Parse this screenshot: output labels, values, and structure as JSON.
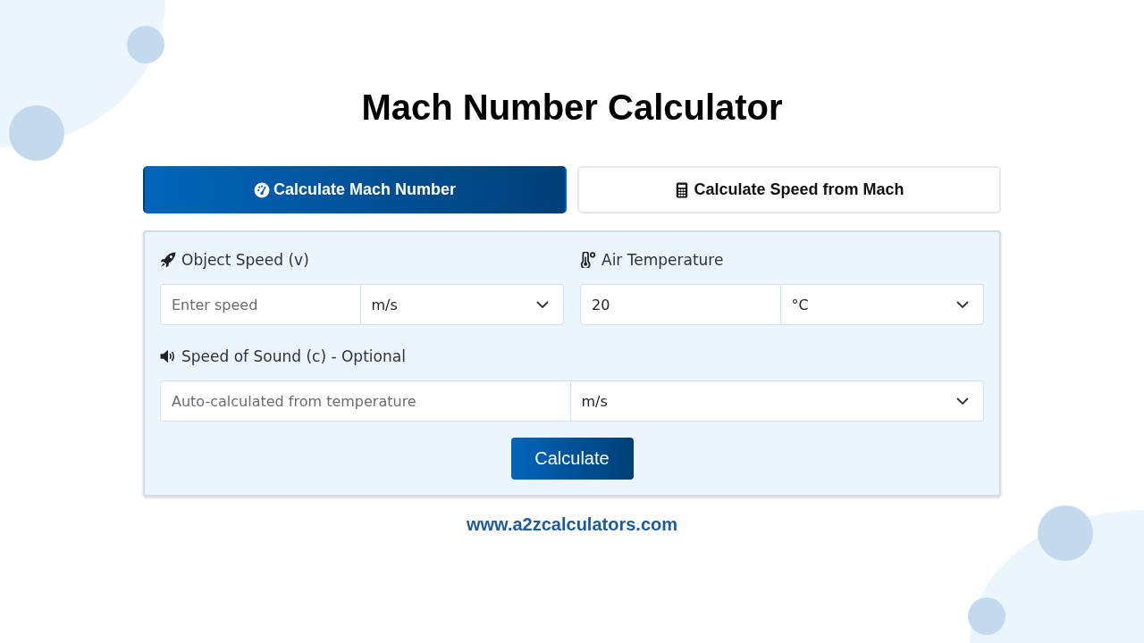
{
  "title": "Mach Number Calculator",
  "tabs": [
    {
      "label": "Calculate Mach Number",
      "selected": true
    },
    {
      "label": "Calculate Speed from Mach",
      "selected": false
    }
  ],
  "fields": [
    {
      "label": "Object Speed (v)",
      "placeholder": "Enter speed",
      "unit": "m/s",
      "wide": false
    },
    {
      "label": "Air Temperature",
      "value": "20",
      "unit": "°C",
      "wide": false
    },
    {
      "label": "Speed of Sound (c) - Optional",
      "placeholder": "Auto-calculated from temperature",
      "unit": "m/s",
      "wide": true
    }
  ],
  "button": "Calculate",
  "footer": "www.a2zcalculators.com"
}
